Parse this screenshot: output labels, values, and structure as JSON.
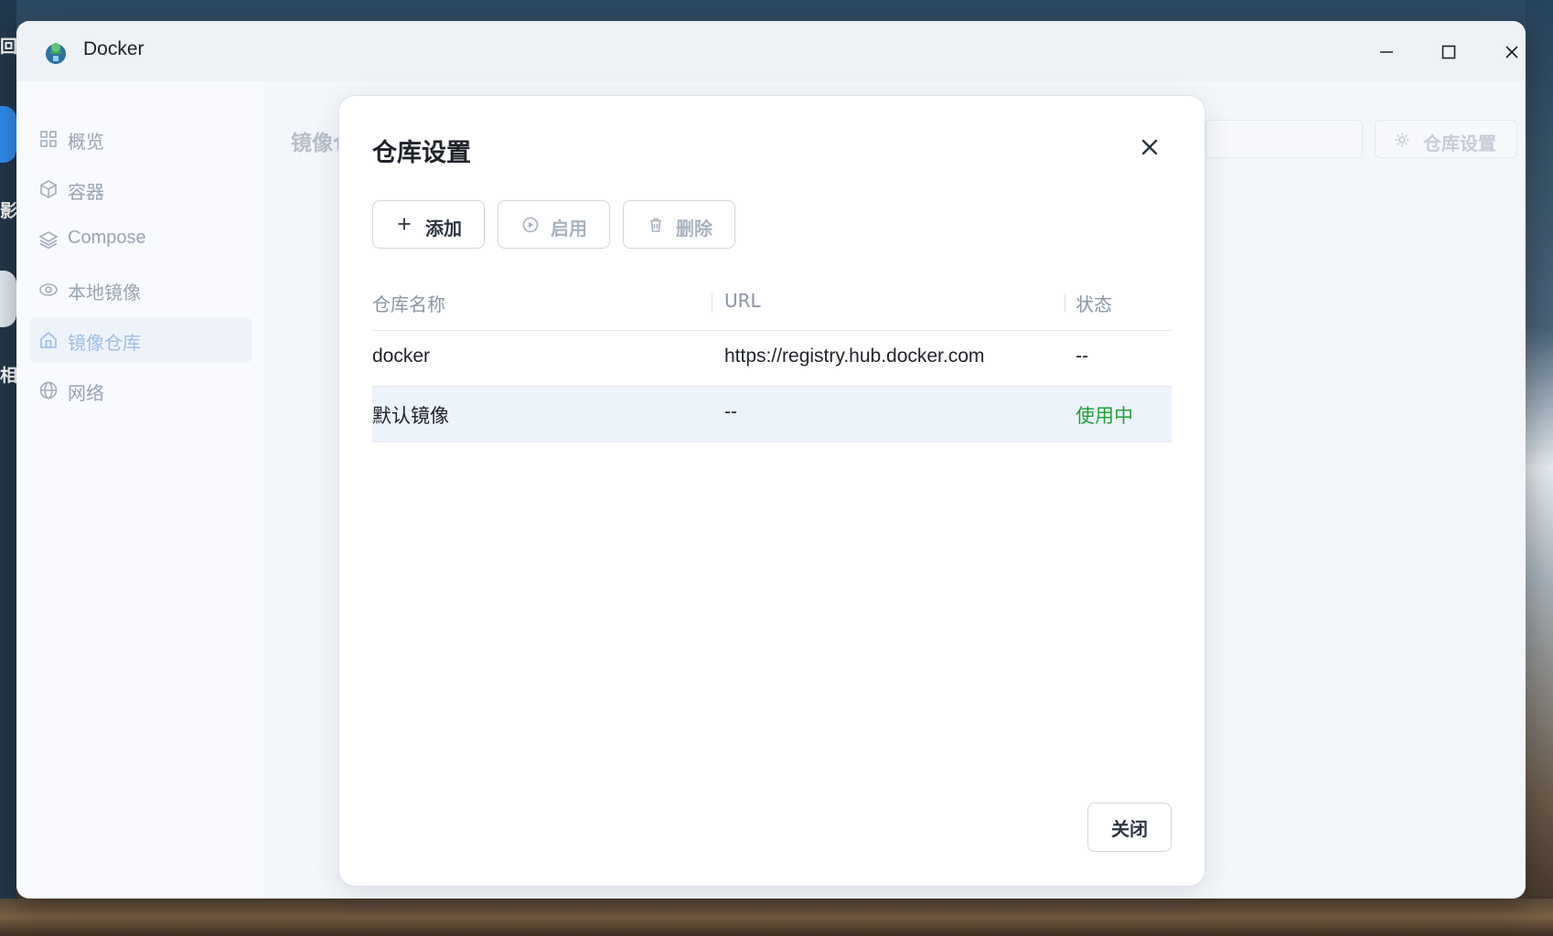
{
  "desktop": {
    "glyphs": [
      "回",
      "影",
      "相"
    ]
  },
  "window": {
    "title": "Docker"
  },
  "sidebar": {
    "items": [
      {
        "label": "概览",
        "icon": "grid-icon"
      },
      {
        "label": "容器",
        "icon": "cube-icon"
      },
      {
        "label": "Compose",
        "icon": "layers-icon"
      },
      {
        "label": "本地镜像",
        "icon": "eye-icon"
      },
      {
        "label": "镜像仓库",
        "icon": "home-icon",
        "active": true
      },
      {
        "label": "网络",
        "icon": "globe-icon"
      }
    ]
  },
  "main": {
    "title": "镜像仓",
    "settings_button": "仓库设置"
  },
  "dialog": {
    "title": "仓库设置",
    "toolbar": {
      "add_label": "添加",
      "enable_label": "启用",
      "delete_label": "删除"
    },
    "table": {
      "columns": [
        "仓库名称",
        "URL",
        "状态"
      ],
      "rows": [
        {
          "name": "docker",
          "url": "https://registry.hub.docker.com",
          "status": "--"
        },
        {
          "name": "默认镜像",
          "url": "--",
          "status": "使用中"
        }
      ]
    },
    "close_button": "关闭"
  },
  "colors": {
    "accent": "#9cbbe4",
    "status_active": "#22a23d",
    "selected_row": "#edf3fb"
  }
}
